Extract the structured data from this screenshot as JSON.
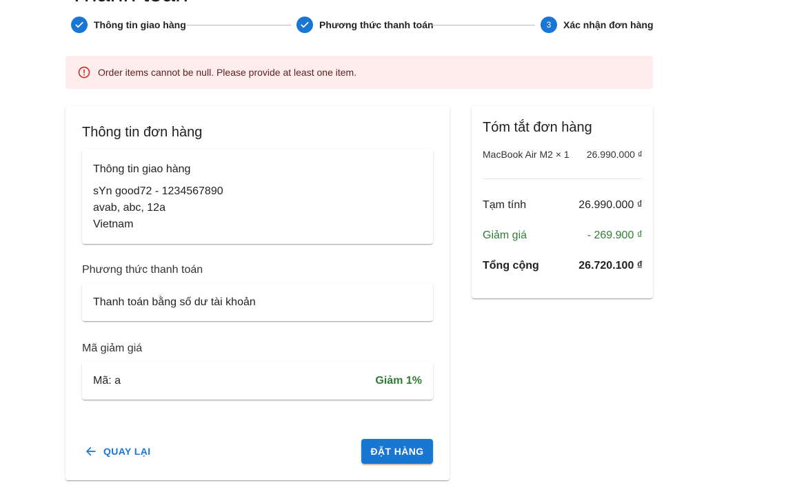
{
  "page": {
    "title": "Thanh toán"
  },
  "stepper": {
    "steps": [
      {
        "label": "Thông tin giao hàng",
        "state": "completed"
      },
      {
        "label": "Phương thức thanh toán",
        "state": "completed"
      },
      {
        "label": "Xác nhận đơn hàng",
        "state": "active",
        "number": "3"
      }
    ]
  },
  "alert": {
    "message": "Order items cannot be null. Please provide at least one item.",
    "icon": "error-outline-icon"
  },
  "order_info": {
    "title": "Thông tin đơn hàng",
    "shipping": {
      "heading": "Thông tin giao hàng",
      "name_phone": "sYn good72 - 1234567890",
      "address": "avab, abc, 12a",
      "country": "Vietnam"
    },
    "payment": {
      "heading": "Phương thức thanh toán",
      "method": "Thanh toán bằng số dư tài khoản"
    },
    "discount": {
      "heading": "Mã giảm giá",
      "code": "Mã: a",
      "value": "Giảm 1%"
    },
    "back_label": "QUAY LẠI",
    "submit_label": "ĐẶT HÀNG"
  },
  "summary": {
    "title": "Tóm tắt đơn hàng",
    "items": [
      {
        "name": "MacBook Air M2 × 1",
        "price": "26.990.000 ₫"
      }
    ],
    "subtotal_label": "Tạm tính",
    "subtotal": "26.990.000 ₫",
    "discount_label": "Giảm giá",
    "discount": "- 269.900 ₫",
    "total_label": "Tổng cộng",
    "total": "26.720.100 ₫"
  },
  "colors": {
    "primary": "#1976d2",
    "success": "#2e7d32",
    "error_bg": "#fdeded",
    "error": "#d32f2f"
  }
}
